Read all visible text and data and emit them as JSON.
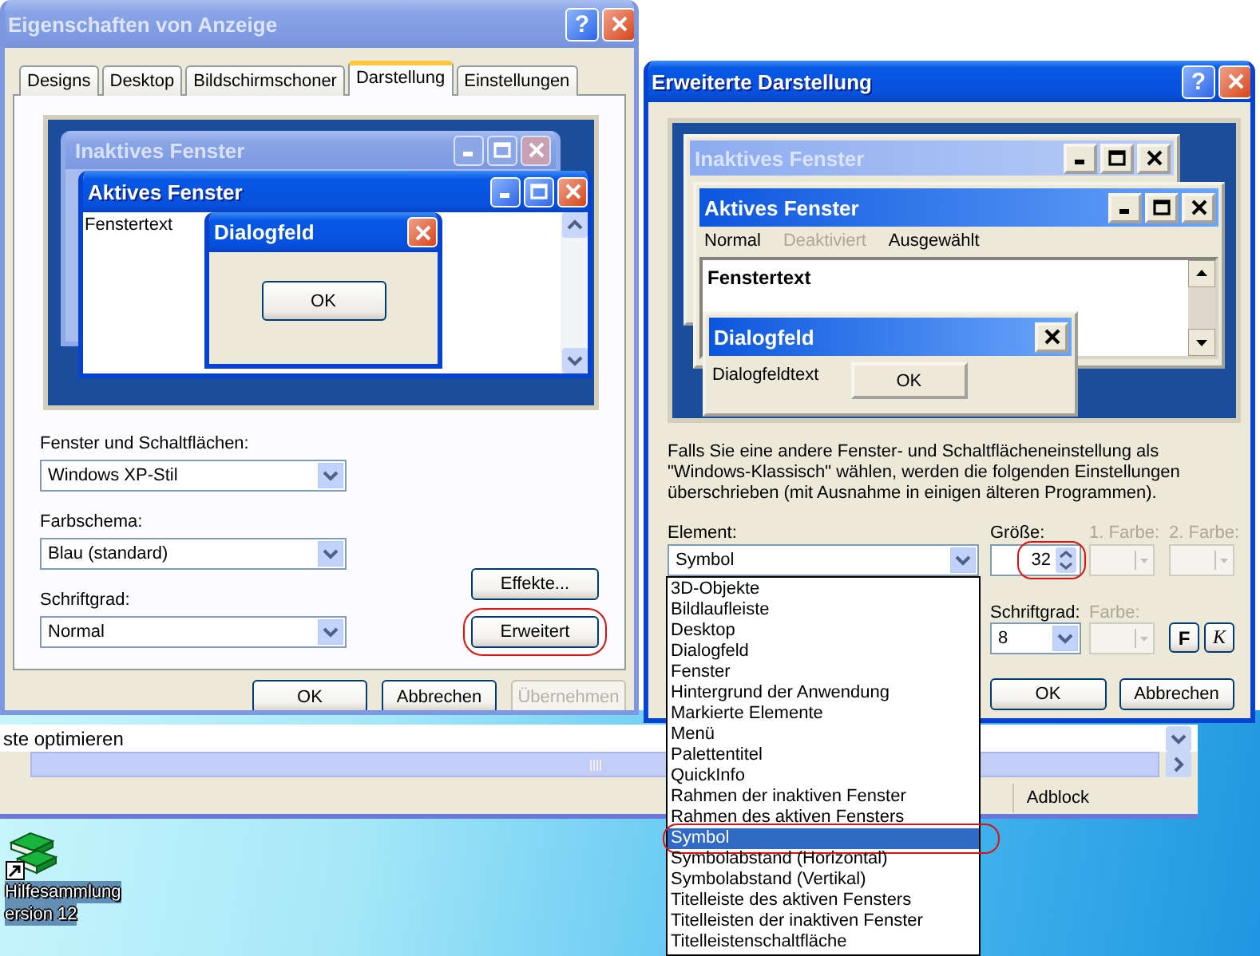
{
  "left_window": {
    "title": "Eigenschaften von Anzeige",
    "help": "?",
    "tabs": [
      {
        "label": "Designs",
        "selected": false
      },
      {
        "label": "Desktop",
        "selected": false
      },
      {
        "label": "Bildschirmschoner",
        "selected": false
      },
      {
        "label": "Darstellung",
        "selected": true
      },
      {
        "label": "Einstellungen",
        "selected": false
      }
    ],
    "preview": {
      "inactive_title": "Inaktives Fenster",
      "active_title": "Aktives Fenster",
      "window_text": "Fenstertext",
      "dialog_title": "Dialogfeld",
      "dialog_button": "OK"
    },
    "fields": [
      {
        "label": "Fenster und Schaltflächen:",
        "value": "Windows XP-Stil"
      },
      {
        "label": "Farbschema:",
        "value": "Blau (standard)"
      },
      {
        "label": "Schriftgrad:",
        "value": "Normal"
      }
    ],
    "side_buttons": [
      {
        "label": "Effekte...",
        "circled": false
      },
      {
        "label": "Erweitert",
        "circled": true
      }
    ],
    "buttons": [
      {
        "label": "OK",
        "disabled": false
      },
      {
        "label": "Abbrechen",
        "disabled": false
      },
      {
        "label": "Übernehmen",
        "disabled": true
      }
    ]
  },
  "advanced_window": {
    "title": "Erweiterte Darstellung",
    "help": "?",
    "preview": {
      "inactive_title": "Inaktives Fenster",
      "active_title": "Aktives Fenster",
      "menu": [
        {
          "label": "Normal",
          "disabled": false
        },
        {
          "label": "Deaktiviert",
          "disabled": true
        },
        {
          "label": "Ausgewählt",
          "disabled": false
        }
      ],
      "window_text": "Fenstertext",
      "dialog_title": "Dialogfeld",
      "dialog_text": "Dialogfeldtext",
      "dialog_button": "OK"
    },
    "note": "Falls Sie eine andere Fenster- und Schaltflächeneinstellung als \"Windows-Klassisch\" wählen, werden die folgenden Einstellungen überschrieben (mit Ausnahme in einigen älteren Programmen).",
    "element": {
      "label": "Element:",
      "value": "Symbol",
      "options": [
        {
          "label": "3D-Objekte",
          "selected": false,
          "circled": false
        },
        {
          "label": "Bildlaufleiste",
          "selected": false,
          "circled": false
        },
        {
          "label": "Desktop",
          "selected": false,
          "circled": false
        },
        {
          "label": "Dialogfeld",
          "selected": false,
          "circled": false
        },
        {
          "label": "Fenster",
          "selected": false,
          "circled": false
        },
        {
          "label": "Hintergrund der Anwendung",
          "selected": false,
          "circled": false
        },
        {
          "label": "Markierte Elemente",
          "selected": false,
          "circled": false
        },
        {
          "label": "Menü",
          "selected": false,
          "circled": false
        },
        {
          "label": "Palettentitel",
          "selected": false,
          "circled": false
        },
        {
          "label": "QuickInfo",
          "selected": false,
          "circled": false
        },
        {
          "label": "Rahmen der inaktiven Fenster",
          "selected": false,
          "circled": false
        },
        {
          "label": "Rahmen des aktiven Fensters",
          "selected": false,
          "circled": false
        },
        {
          "label": "Symbol",
          "selected": true,
          "circled": true
        },
        {
          "label": "Symbolabstand (Horizontal)",
          "selected": false,
          "circled": false
        },
        {
          "label": "Symbolabstand (Vertikal)",
          "selected": false,
          "circled": false
        },
        {
          "label": "Titelleiste des aktiven Fensters",
          "selected": false,
          "circled": false
        },
        {
          "label": "Titelleisten der inaktiven Fenster",
          "selected": false,
          "circled": false
        },
        {
          "label": "Titelleistenschaltfläche",
          "selected": false,
          "circled": false
        }
      ]
    },
    "size": {
      "label": "Größe:",
      "value": "32",
      "circled": true
    },
    "color1": {
      "label": "1. Farbe:",
      "disabled": true
    },
    "color2": {
      "label": "2. Farbe:",
      "disabled": true
    },
    "font_size": {
      "label": "Schriftgrad:",
      "value": "8"
    },
    "font_color": {
      "label": "Farbe:",
      "disabled": true
    },
    "style_buttons": [
      {
        "label": "F",
        "kind": "bold"
      },
      {
        "label": "K",
        "kind": "italic"
      }
    ],
    "buttons": [
      {
        "label": "OK"
      },
      {
        "label": "Abbrechen"
      }
    ]
  },
  "browser_window": {
    "text": "ste optimieren",
    "status": "Adblock"
  },
  "desktop_icon": {
    "lines": [
      "Hilfesammlung",
      "ersion 12"
    ]
  }
}
